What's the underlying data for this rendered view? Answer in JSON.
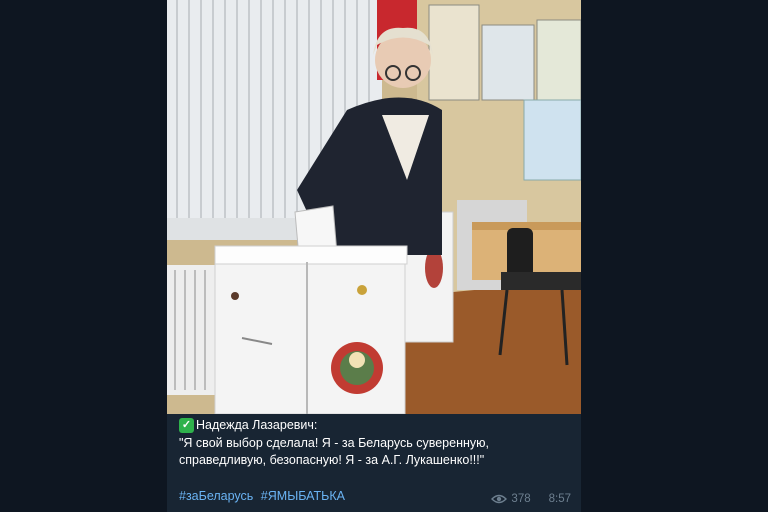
{
  "post": {
    "photo_icon": "ballot-box-photo",
    "author_icon": "check-mark-icon",
    "author": "Надежда Лазаревич:",
    "quote_line1": "\"Я свой выбор сделала! Я - за Беларусь суверенную,",
    "quote_line2": "справедливую, безопасную! Я - за А.Г. Лукашенко!!!\"",
    "tags": [
      "#заБеларусь",
      "#ЯМЫБАТЬКА"
    ],
    "views": "378",
    "time": "8:57",
    "view_icon": "eye-icon"
  },
  "colors": {
    "background": "#0e1621",
    "bubble": "#182533",
    "link": "#6ab3f3",
    "meta": "#6d7f8f",
    "check": "#2fb24c"
  }
}
